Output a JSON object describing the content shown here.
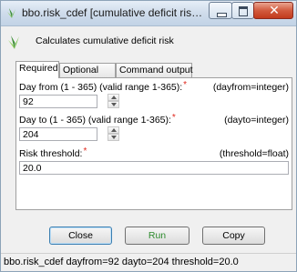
{
  "window": {
    "title": "bbo.risk_cdef [cumulative deficit risk,...",
    "description": "Calculates cumulative deficit risk"
  },
  "tabs": [
    {
      "label": "Required",
      "active": true
    },
    {
      "label": "Optional",
      "active": false
    },
    {
      "label": "Command output",
      "active": false
    }
  ],
  "fields": {
    "dayfrom": {
      "label": "Day from (1 - 365) (valid range 1-365):",
      "required_mark": "*",
      "type_hint": "(dayfrom=integer)",
      "value": "92"
    },
    "dayto": {
      "label": "Day to (1 - 365) (valid range 1-365):",
      "required_mark": "*",
      "type_hint": "(dayto=integer)",
      "value": "204"
    },
    "threshold": {
      "label": "Risk threshold:",
      "required_mark": "*",
      "type_hint": "(threshold=float)",
      "value": "20.0"
    }
  },
  "buttons": {
    "close": "Close",
    "run": "Run",
    "copy": "Copy"
  },
  "status": "bbo.risk_cdef dayfrom=92 dayto=204 threshold=20.0",
  "icons": {
    "app": "grass-leaf-icon",
    "description": "grass-leaf-icon"
  },
  "colors": {
    "required_mark": "#e0281e",
    "run_text": "#2e8b2e",
    "close_button_bg": "#c23a1c"
  }
}
